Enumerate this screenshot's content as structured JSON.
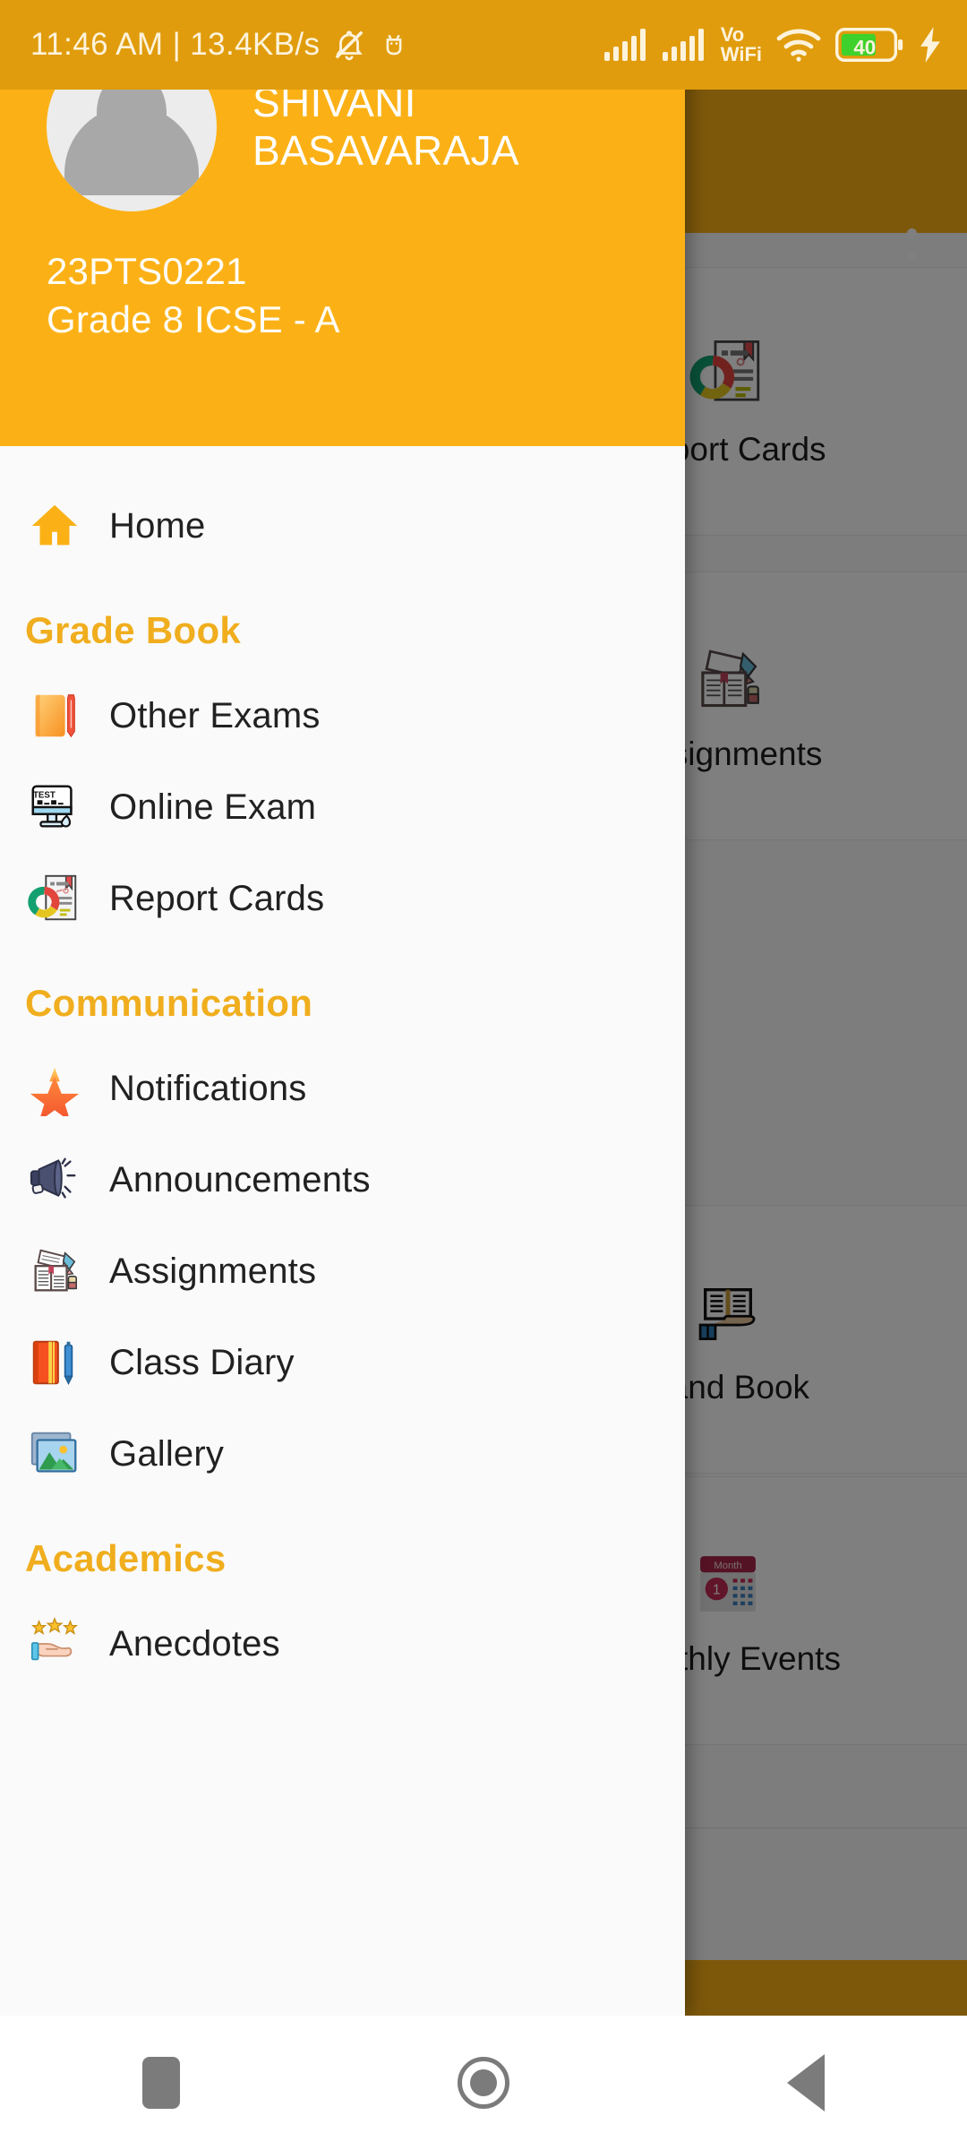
{
  "status_bar": {
    "clock": "11:46 AM | 13.4KB/s",
    "icons": [
      "bell-muted-icon",
      "android-robot-icon",
      "signal-bars-sim1-icon",
      "signal-bars-sim2-icon",
      "vowifi-icon",
      "wifi-icon",
      "battery-icon",
      "charging-bolt-icon"
    ],
    "vowifi_top": "Vo",
    "vowifi_bottom": "WiFi",
    "battery_level": "40",
    "battery_color": "#3ED12B",
    "background_color": "#E09C0C"
  },
  "drawer": {
    "accent_color": "#FBB116",
    "header": {
      "avatar": "default-user-avatar",
      "student_name": "SHIVANI BASAVARAJA",
      "student_id": "23PTS0221",
      "student_class": "Grade 8 ICSE - A"
    },
    "items": [
      {
        "type": "item",
        "label": "Home",
        "icon": "home-icon"
      },
      {
        "type": "section",
        "label": "Grade Book"
      },
      {
        "type": "item",
        "label": "Other Exams",
        "icon": "notebook-pencil-icon"
      },
      {
        "type": "item",
        "label": "Online Exam",
        "icon": "test-monitor-icon"
      },
      {
        "type": "item",
        "label": "Report Cards",
        "icon": "report-card-icon"
      },
      {
        "type": "section",
        "label": "Communication"
      },
      {
        "type": "item",
        "label": "Notifications",
        "icon": "star-notification-icon"
      },
      {
        "type": "item",
        "label": "Announcements",
        "icon": "megaphone-icon"
      },
      {
        "type": "item",
        "label": "Assignments",
        "icon": "assignment-book-icon"
      },
      {
        "type": "item",
        "label": "Class Diary",
        "icon": "diary-pen-icon"
      },
      {
        "type": "item",
        "label": "Gallery",
        "icon": "gallery-photos-icon"
      },
      {
        "type": "section",
        "label": "Academics"
      },
      {
        "type": "item",
        "label": "Anecdotes",
        "icon": "stars-hand-icon"
      }
    ]
  },
  "background_app": {
    "appbar_color": "#FBB116",
    "overflow_menu": "overflow-menu-icon",
    "cards": [
      {
        "label": "Report Cards",
        "icon": "report-card-icon"
      },
      {
        "label": "Assignments",
        "icon": "assignment-book-icon"
      },
      {
        "label": "Hand Book",
        "icon": "handbook-icon"
      },
      {
        "label": "Monthly Events",
        "icon": "calendar-month-icon",
        "calendar_month_label": "Month",
        "calendar_day": "1"
      }
    ],
    "social": [
      {
        "icon": "twitter-icon"
      }
    ]
  },
  "nav_bar": {
    "buttons": [
      {
        "name": "recents",
        "icon": "recents-square-icon"
      },
      {
        "name": "home",
        "icon": "home-circle-icon"
      },
      {
        "name": "back",
        "icon": "back-triangle-icon"
      }
    ]
  }
}
